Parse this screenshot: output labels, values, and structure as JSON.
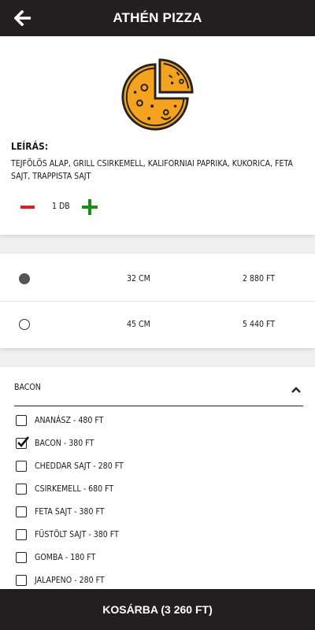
{
  "header": {
    "title": "Athén pizza",
    "back_icon": "arrow-left-icon"
  },
  "product": {
    "image_icon": "pizza-icon",
    "description_heading": "Leírás:",
    "description": "Tejfölös alap, grill csirkemell, kaliforniai paprika, kukorica, feta sajt, trappista sajt",
    "quantity": "1 db"
  },
  "sizes": [
    {
      "label": "32 cm",
      "price": "2 880 Ft",
      "selected": true
    },
    {
      "label": "45 cm",
      "price": "5 440 Ft",
      "selected": false
    }
  ],
  "toppings": {
    "header_label": "Bacon",
    "expanded": true,
    "items": [
      {
        "label": "Ananász - 480 Ft",
        "checked": false
      },
      {
        "label": "Bacon - 380 Ft",
        "checked": true
      },
      {
        "label": "Cheddar sajt - 280 Ft",
        "checked": false
      },
      {
        "label": "Csirkemell - 680 Ft",
        "checked": false
      },
      {
        "label": "Feta sajt - 380 Ft",
        "checked": false
      },
      {
        "label": "Füstölt sajt - 380 Ft",
        "checked": false
      },
      {
        "label": "Gomba - 180 Ft",
        "checked": false
      },
      {
        "label": "Jalapeno - 280 Ft",
        "checked": false
      }
    ]
  },
  "cart_button": "Kosárba (3 260 Ft)",
  "colors": {
    "bar_background": "#231f20",
    "pizza_orange": "#f5a21e",
    "minus_red": "#e01e1e",
    "plus_green": "#1a8c1a"
  }
}
